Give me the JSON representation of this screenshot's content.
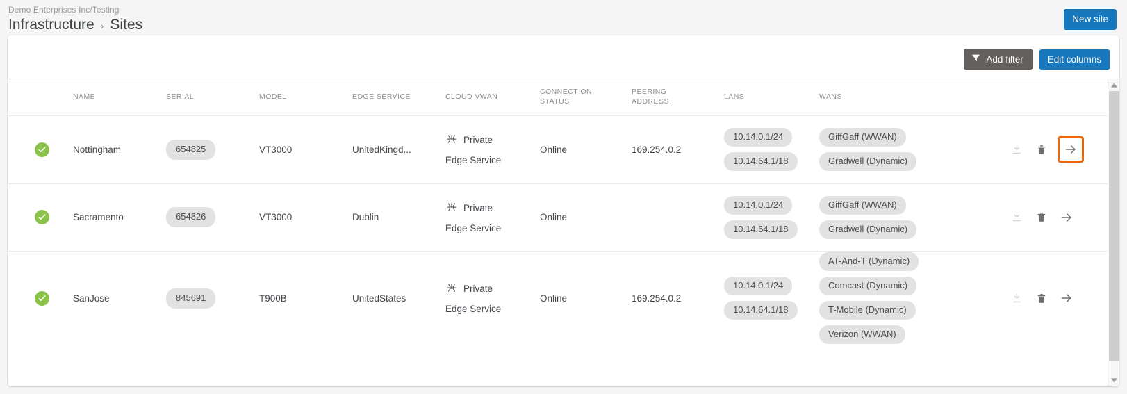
{
  "header": {
    "org_path": "Demo Enterprises Inc/Testing",
    "breadcrumb": {
      "parent": "Infrastructure",
      "separator": "›",
      "current": "Sites"
    },
    "new_site_label": "New site"
  },
  "toolbar": {
    "add_filter_label": "Add filter",
    "edit_columns_label": "Edit columns",
    "filter_icon": "funnel-icon"
  },
  "table": {
    "columns": [
      {
        "key": "status",
        "label": ""
      },
      {
        "key": "name",
        "label": "NAME"
      },
      {
        "key": "serial",
        "label": "SERIAL"
      },
      {
        "key": "model",
        "label": "MODEL"
      },
      {
        "key": "edge_service",
        "label": "EDGE SERVICE"
      },
      {
        "key": "cloud_vwan",
        "label": "CLOUD VWAN"
      },
      {
        "key": "connection_status",
        "label_line1": "CONNECTION",
        "label_line2": "STATUS"
      },
      {
        "key": "peering_address",
        "label_line1": "PEERING",
        "label_line2": "ADDRESS"
      },
      {
        "key": "lans",
        "label": "LANS"
      },
      {
        "key": "wans",
        "label": "WANS"
      },
      {
        "key": "actions",
        "label": ""
      }
    ],
    "rows": [
      {
        "status": "ok",
        "name": "Nottingham",
        "serial": "654825",
        "model": "VT3000",
        "edge_service": "UnitedKingd...",
        "cloud_vwan_title": "Private",
        "cloud_vwan_sub": "Edge Service",
        "cloud_vwan_icon": "hub-node-icon",
        "connection_status": "Online",
        "peering_address": "169.254.0.2",
        "lans": [
          "10.14.0.1/24",
          "10.14.64.1/18"
        ],
        "wans": [
          "GiffGaff (WWAN)",
          "Gradwell (Dynamic)"
        ],
        "actions": {
          "download": "download-icon",
          "delete": "trash-icon",
          "open": "arrow-right-icon"
        },
        "open_highlighted": true
      },
      {
        "status": "ok",
        "name": "Sacramento",
        "serial": "654826",
        "model": "VT3000",
        "edge_service": "Dublin",
        "cloud_vwan_title": "Private",
        "cloud_vwan_sub": "Edge Service",
        "cloud_vwan_icon": "hub-node-icon",
        "connection_status": "Online",
        "peering_address": "",
        "lans": [
          "10.14.0.1/24",
          "10.14.64.1/18"
        ],
        "wans": [
          "GiffGaff (WWAN)",
          "Gradwell (Dynamic)"
        ],
        "actions": {
          "download": "download-icon",
          "delete": "trash-icon",
          "open": "arrow-right-icon"
        },
        "open_highlighted": false
      },
      {
        "status": "ok",
        "name": "SanJose",
        "serial": "845691",
        "model": "T900B",
        "edge_service": "UnitedStates",
        "cloud_vwan_title": "Private",
        "cloud_vwan_sub": "Edge Service",
        "cloud_vwan_icon": "hub-node-icon",
        "connection_status": "Online",
        "peering_address": "169.254.0.2",
        "lans": [
          "10.14.0.1/24",
          "10.14.64.1/18"
        ],
        "wans": [
          "AT-And-T (Dynamic)",
          "Comcast (Dynamic)",
          "T-Mobile (Dynamic)",
          "Verizon (WWAN)"
        ],
        "actions": {
          "download": "download-icon",
          "delete": "trash-icon",
          "open": "arrow-right-icon"
        },
        "open_highlighted": false
      }
    ]
  },
  "colors": {
    "primary_blue": "#1878bd",
    "filter_gray": "#63605d",
    "status_green": "#8bc34a",
    "highlight_orange": "#ec6608",
    "chip_bg": "#e2e2e2",
    "page_bg": "#f5f5f5"
  },
  "scrollbar": {
    "up": "scroll-up-arrow",
    "down": "scroll-down-arrow"
  }
}
